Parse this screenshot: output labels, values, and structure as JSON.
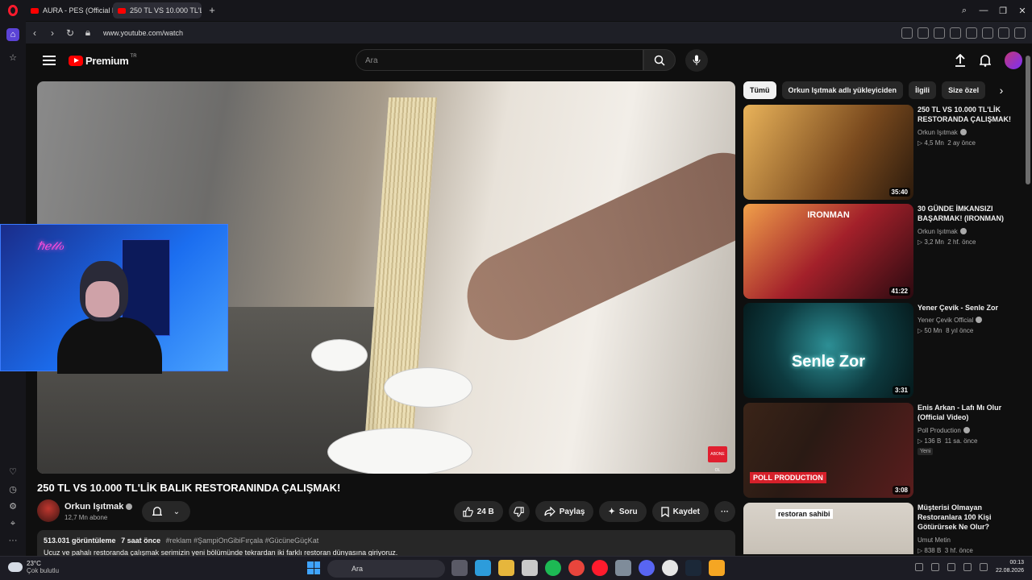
{
  "browser": {
    "tabs": [
      {
        "label": "AURA - PES (Official Musi",
        "active": false
      },
      {
        "label": "250 TL VS 10.000 TL'LİK",
        "active": true
      }
    ],
    "url": "www.youtube.com/watch"
  },
  "youtube": {
    "logo_text": "Premium",
    "logo_sup": "TR",
    "search_placeholder": "Ara"
  },
  "video": {
    "title": "250 TL VS 10.000 TL'LİK BALIK RESTORANINDA ÇALIŞMAK!",
    "subscribe_badge": "ABONE OL",
    "channel": {
      "name": "Orkun Işıtmak",
      "subscribers": "12,7 Mn abone"
    },
    "actions": {
      "likes": "24 B",
      "share": "Paylaş",
      "ask": "Soru",
      "save": "Kaydet"
    },
    "description": {
      "views": "513.031 görüntüleme",
      "age": "7 saat önce",
      "tags": "#reklam #ŞampiOnGibiFırçala #GücüneGüçKat",
      "text": "Ucuz ve pahalı restoranda çalışmak serimizin yeni bölümünde tekrardan iki farklı restoran dünyasına giriyoruz."
    }
  },
  "webcam": {
    "neon_text": "ℏℯ𝓁𝓁ℴ"
  },
  "chips": [
    "Tümü",
    "Orkun Işıtmak adlı yükleyiciden",
    "İlgili",
    "Size özel"
  ],
  "recommendations": [
    {
      "title": "250 TL VS 10.000 TL'LİK RESTORANDA ÇALIŞMAK!",
      "channel": "Orkun Işıtmak",
      "views": "4,5 Mn",
      "age": "2 ay önce",
      "duration": "35:40",
      "thumb_color": "#7a4a1e",
      "thumb_text": ""
    },
    {
      "title": "30 GÜNDE İMKANSIZI BAŞARMAK! (IRONMAN)",
      "channel": "Orkun Işıtmak",
      "views": "3,2 Mn",
      "age": "2 hf. önce",
      "duration": "41:22",
      "thumb_color": "#a3202a",
      "thumb_text": "IRONMAN"
    },
    {
      "title": "Yener Çevik - Senle Zor",
      "channel": "Yener Çevik Official",
      "views": "50 Mn",
      "age": "8 yıl önce",
      "duration": "3:31",
      "thumb_color": "#0d3a3f",
      "thumb_text": "Senle Zor"
    },
    {
      "title": "Enis Arkan - Lafı Mı Olur (Official Video)",
      "channel": "Poll Production",
      "views": "136 B",
      "age": "11 sa. önce",
      "duration": "3:08",
      "thumb_color": "#2a1a14",
      "thumb_text": "POLL PRODUCTION",
      "badge": "Yeni"
    },
    {
      "title": "Müşterisi Olmayan Restoranlara 100 Kişi Götürürsek Ne Olur?",
      "channel": "Umut Metin",
      "views": "838 B",
      "age": "3 hf. önce",
      "duration": "",
      "thumb_color": "#c9c2b8",
      "thumb_text": "restoran sahibi"
    }
  ],
  "taskbar": {
    "weather_temp": "23°C",
    "weather_desc": "Çok bulutlu",
    "search_label": "Ara",
    "time": "00:13",
    "date": "22.08.2026"
  }
}
